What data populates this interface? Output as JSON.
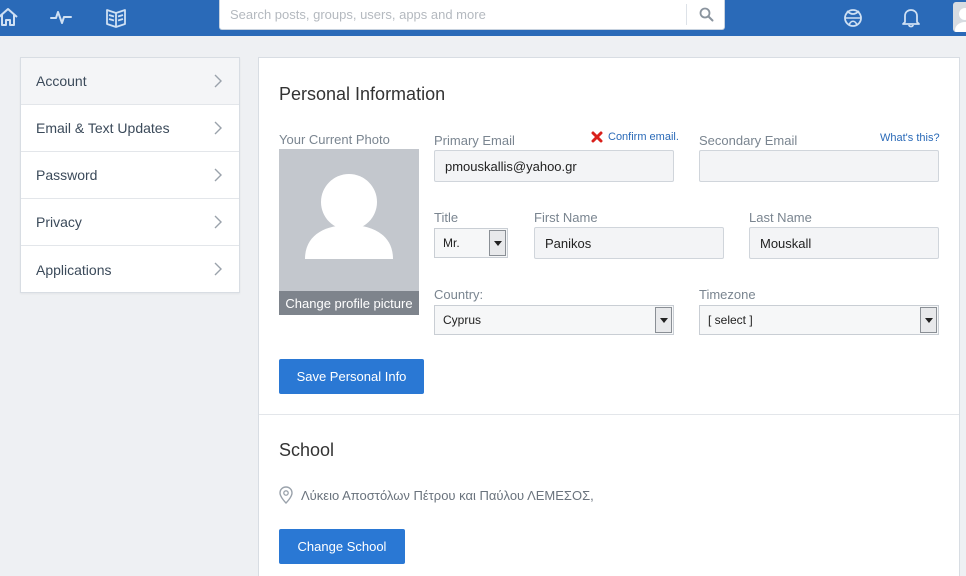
{
  "topbar": {
    "icons": [
      "home-icon",
      "activity-icon",
      "library-icon",
      "sphere-icon",
      "bell-icon"
    ],
    "search_placeholder": "Search posts, groups, users, apps and more"
  },
  "sidebar": {
    "items": [
      {
        "label": "Account",
        "active": true
      },
      {
        "label": "Email & Text Updates",
        "active": false
      },
      {
        "label": "Password",
        "active": false
      },
      {
        "label": "Privacy",
        "active": false
      },
      {
        "label": "Applications",
        "active": false
      }
    ]
  },
  "personal": {
    "title": "Personal Information",
    "photo_label": "Your Current Photo",
    "change_photo": "Change profile picture",
    "primary_email_label": "Primary Email",
    "confirm_email": "Confirm email.",
    "primary_email_value": "pmouskallis@yahoo.gr",
    "secondary_email_label": "Secondary Email",
    "whats_this": "What's this?",
    "secondary_email_value": "",
    "title_label": "Title",
    "title_value": "Mr.",
    "first_name_label": "First Name",
    "first_name_value": "Panikos",
    "last_name_label": "Last Name",
    "last_name_value": "Mouskall",
    "country_label": "Country:",
    "country_value": "Cyprus",
    "timezone_label": "Timezone",
    "timezone_value": "[ select ]",
    "save_button": "Save Personal Info"
  },
  "school": {
    "title": "School",
    "name": "Λύκειο Αποστόλων Πέτρου και Παύλου ΛΕΜΕΣΟΣ,",
    "change_button": "Change School"
  },
  "colors": {
    "topbar": "#2a6ab8",
    "primary_button": "#2a78d4",
    "confirm_x": "#d9201b"
  }
}
